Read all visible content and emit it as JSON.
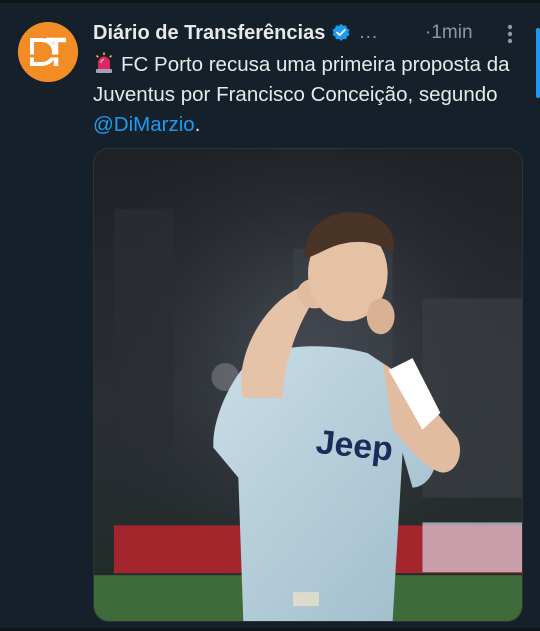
{
  "tweet": {
    "account_name": "Diário de Transferências",
    "handle_truncated": "...",
    "separator": "·",
    "time": "1min",
    "verified": true,
    "avatar": {
      "initials": "DT",
      "bg_color": "#f28d26"
    },
    "text": {
      "emoji_icon": "siren-icon",
      "body": "FC Porto recusa uma primeira proposta da Juventus por Francisco Conceição, segundo ",
      "mention": "@DiMarzio",
      "trailing": "."
    },
    "media": {
      "shirt_sponsor": "Jeep",
      "alt": "Francisco Conceição a celebrar com a camisola da Juventus"
    }
  },
  "colors": {
    "background": "#15202b",
    "text": "#e7e9ea",
    "muted": "#8b98a5",
    "accent": "#1d9bf0"
  },
  "icons": {
    "verified": "verified-badge-icon",
    "more": "more-options-icon"
  }
}
